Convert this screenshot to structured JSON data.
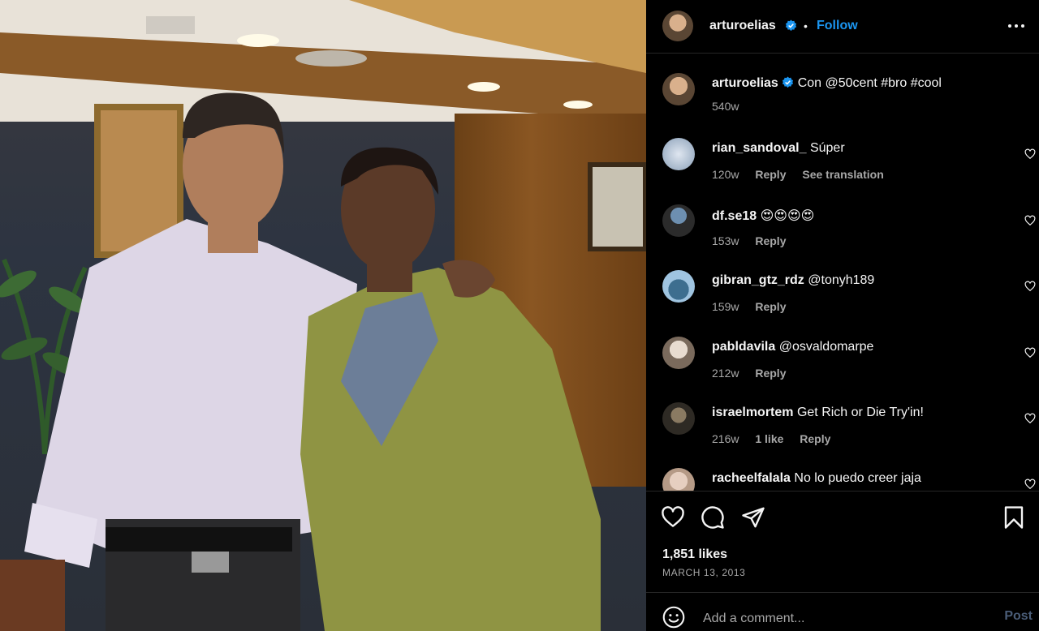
{
  "post": {
    "author": "arturoelias",
    "verified": true,
    "follow_label": "Follow",
    "separator": "•",
    "caption": {
      "username": "arturoelias",
      "text": "Con @50cent #bro #cool",
      "age": "540w"
    }
  },
  "comments": [
    {
      "username": "rian_sandoval_",
      "text": "Súper",
      "age": "120w",
      "likes": "",
      "reply": "Reply",
      "translate": "See translation"
    },
    {
      "username": "df.se18",
      "text": "😍😍😍😍",
      "age": "153w",
      "likes": "",
      "reply": "Reply",
      "translate": ""
    },
    {
      "username": "gibran_gtz_rdz",
      "text": "@tonyh189",
      "age": "159w",
      "likes": "",
      "reply": "Reply",
      "translate": ""
    },
    {
      "username": "pabldavila",
      "text": "@osvaldomarpe",
      "age": "212w",
      "likes": "",
      "reply": "Reply",
      "translate": ""
    },
    {
      "username": "israelmortem",
      "text": "Get Rich or Die Try'in!",
      "age": "216w",
      "likes": "1 like",
      "reply": "Reply",
      "translate": ""
    },
    {
      "username": "racheelfalala",
      "text": "No lo puedo creer jaja",
      "age": "",
      "likes": "",
      "reply": "",
      "translate": ""
    }
  ],
  "stats": {
    "likes": "1,851 likes",
    "date": "MARCH 13, 2013"
  },
  "composer": {
    "placeholder": "Add a comment...",
    "post_label": "Post"
  },
  "icons": {
    "more": "more-horizontal-icon",
    "like": "heart-icon",
    "comment": "comment-icon",
    "share": "share-icon",
    "save": "bookmark-icon",
    "emoji": "emoji-icon",
    "verified": "verified-badge-icon"
  },
  "colors": {
    "background": "#000000",
    "follow": "#1b95f0",
    "verified": "#1b95f0",
    "muted": "#a8a8a8",
    "post_disabled": "#4a5d78"
  }
}
